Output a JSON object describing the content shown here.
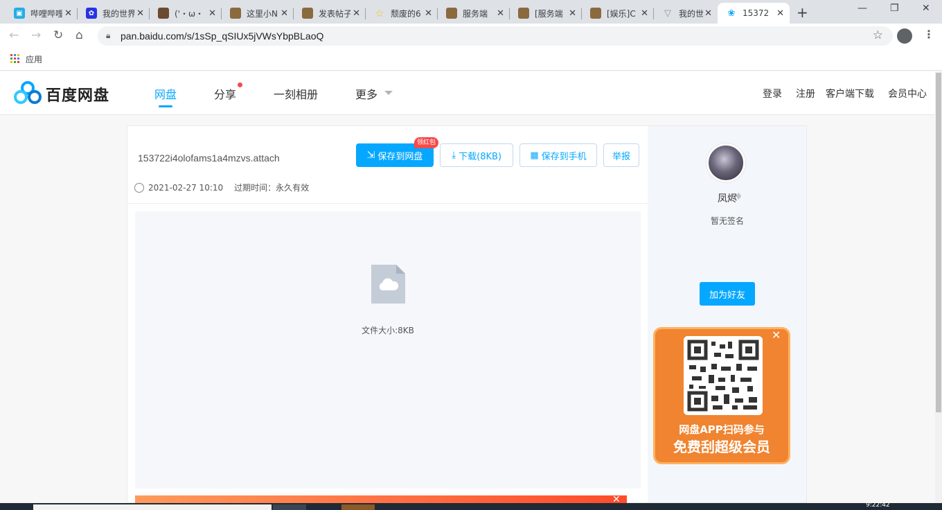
{
  "browser": {
    "tabs": [
      {
        "title": "哔哩哔哩",
        "favicon": "bilibili-icon",
        "color": "#23ade5"
      },
      {
        "title": "我的世界",
        "favicon": "baidu-paw-icon",
        "color": "#2932e1"
      },
      {
        "title": "('・ω・",
        "favicon": "minecraft-head-icon",
        "color": "#6b4a2f"
      },
      {
        "title": "这里小N",
        "favicon": "minecraft-block-icon",
        "color": "#8b6a3e"
      },
      {
        "title": "发表帖子",
        "favicon": "minecraft-block-icon",
        "color": "#8b6a3e"
      },
      {
        "title": "颓废的6",
        "favicon": "star-icon",
        "color": "#f5c518"
      },
      {
        "title": "服务端",
        "favicon": "minecraft-block-icon",
        "color": "#8b6a3e"
      },
      {
        "title": "[服务端",
        "favicon": "minecraft-block-icon",
        "color": "#8b6a3e"
      },
      {
        "title": "[娱乐]C",
        "favicon": "minecraft-block-icon",
        "color": "#8b6a3e"
      },
      {
        "title": "我的世界",
        "favicon": "vue-icon",
        "color": "#8899aa"
      },
      {
        "title": "15372",
        "favicon": "baidu-netdisk-icon",
        "color": "#06a7ff",
        "active": true
      }
    ],
    "url": "pan.baidu.com/s/1sSp_qSIUx5jVWsYbpBLaoQ",
    "bookmarks_label": "应用"
  },
  "header": {
    "brand": "百度网盘",
    "nav": [
      "网盘",
      "分享",
      "一刻相册",
      "更多"
    ],
    "links": [
      "登录",
      "注册",
      "客户端下载",
      "会员中心"
    ],
    "accent": "#06a7ff"
  },
  "file": {
    "name": "153722i4olofams1a4mzvs.attach",
    "date": "2021-02-27 10:10",
    "expire": "过期时间：永久有效",
    "size_text": "文件大小:8KB",
    "buttons": {
      "save": "保存到网盘",
      "badge": "领红包",
      "download": "下载(8KB)",
      "save_phone": "保存到手机",
      "report": "举报"
    }
  },
  "sidebar": {
    "username": "凤烬",
    "signature": "暂无签名",
    "add_friend": "加为好友",
    "promo_line1": "网盘APP扫码参与",
    "promo_line2": "免费刮超级会员"
  },
  "taskbar": {
    "clock": "9:22:42"
  }
}
